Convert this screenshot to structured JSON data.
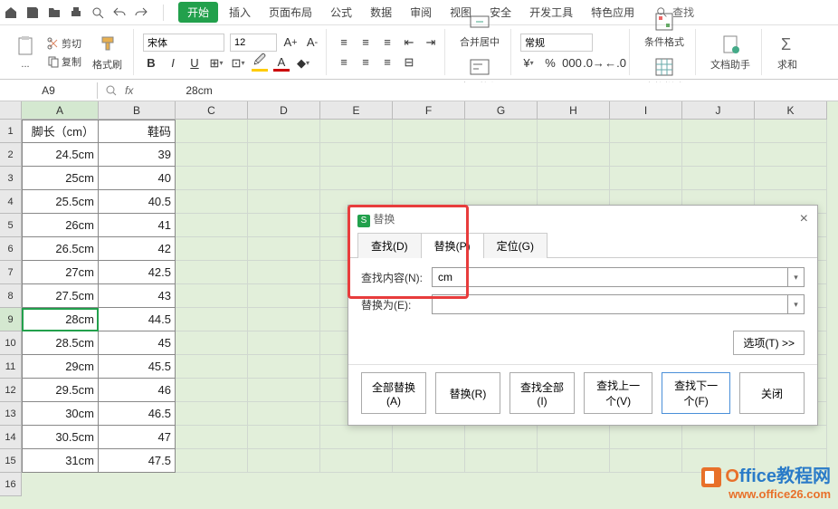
{
  "tabs": {
    "start": "开始",
    "insert": "插入",
    "layout": "页面布局",
    "formula": "公式",
    "data": "数据",
    "review": "审阅",
    "view": "视图",
    "security": "安全",
    "dev": "开发工具",
    "special": "特色应用"
  },
  "search": {
    "label": "查找"
  },
  "ribbon": {
    "cut": "剪切",
    "copy": "复制",
    "format_painter": "格式刷",
    "paste": "...",
    "font": "宋体",
    "size": "12",
    "merge": "合并居中",
    "wrap": "自动换行",
    "number_fmt": "常规",
    "cond_fmt": "条件格式",
    "table_style": "表格样式",
    "doc_helper": "文档助手",
    "sum": "求和"
  },
  "name_box": "A9",
  "formula": "28cm",
  "columns": [
    "A",
    "B",
    "C",
    "D",
    "E",
    "F",
    "G",
    "H",
    "I",
    "J",
    "K"
  ],
  "rows": [
    {
      "n": "1",
      "a": "脚长（cm）",
      "b": "鞋码"
    },
    {
      "n": "2",
      "a": "24.5cm",
      "b": "39"
    },
    {
      "n": "3",
      "a": "25cm",
      "b": "40"
    },
    {
      "n": "4",
      "a": "25.5cm",
      "b": "40.5"
    },
    {
      "n": "5",
      "a": "26cm",
      "b": "41"
    },
    {
      "n": "6",
      "a": "26.5cm",
      "b": "42"
    },
    {
      "n": "7",
      "a": "27cm",
      "b": "42.5"
    },
    {
      "n": "8",
      "a": "27.5cm",
      "b": "43"
    },
    {
      "n": "9",
      "a": "28cm",
      "b": "44.5"
    },
    {
      "n": "10",
      "a": "28.5cm",
      "b": "45"
    },
    {
      "n": "11",
      "a": "29cm",
      "b": "45.5"
    },
    {
      "n": "12",
      "a": "29.5cm",
      "b": "46"
    },
    {
      "n": "13",
      "a": "30cm",
      "b": "46.5"
    },
    {
      "n": "14",
      "a": "30.5cm",
      "b": "47"
    },
    {
      "n": "15",
      "a": "31cm",
      "b": "47.5"
    }
  ],
  "dialog": {
    "title": "替换",
    "app_icon": "S",
    "tab_find": "查找(D)",
    "tab_replace": "替换(P)",
    "tab_goto": "定位(G)",
    "find_label": "查找内容(N):",
    "find_value": "cm",
    "replace_label": "替换为(E):",
    "replace_value": "",
    "options": "选项(T) >>",
    "btn_replace_all": "全部替换(A)",
    "btn_replace": "替换(R)",
    "btn_find_all": "查找全部(I)",
    "btn_find_prev": "查找上一个(V)",
    "btn_find_next": "查找下一个(F)",
    "btn_close": "关闭"
  },
  "watermark": {
    "line1a": "O",
    "line1b": "ffice教程网",
    "line2": "www.office26.com"
  }
}
